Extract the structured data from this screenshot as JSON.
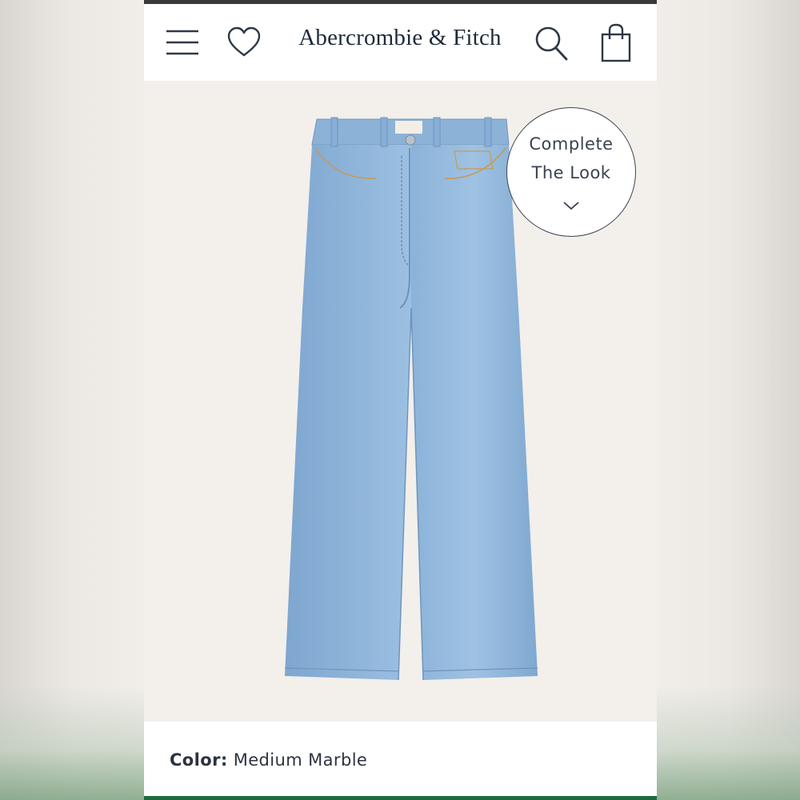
{
  "header": {
    "brand": "Abercrombie & Fitch",
    "icons": [
      "menu-icon",
      "heart-icon",
      "search-icon",
      "shopping-bag-icon"
    ]
  },
  "product": {
    "image": "jeans-image",
    "complete_the_look": {
      "line1": "Complete",
      "line2": "The Look",
      "icon": "chevron-down-icon"
    },
    "color_label": "Color:",
    "color_value": "Medium Marble"
  },
  "colors": {
    "brand_text": "#1d2a3a",
    "denim": "#8fb4d8",
    "accent_green": "#1d6b3f"
  }
}
